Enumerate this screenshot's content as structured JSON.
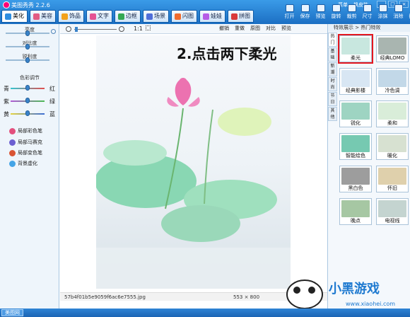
{
  "app": {
    "title": "美图秀秀 2.2.6",
    "menu": [
      "菜单",
      "换皮肤"
    ]
  },
  "tabs": [
    {
      "label": "美化",
      "icon": "brush-icon",
      "color": "#2f8ee0"
    },
    {
      "label": "美容",
      "icon": "face-icon",
      "color": "#e25b82"
    },
    {
      "label": "饰品",
      "icon": "gem-icon",
      "color": "#f2a21c"
    },
    {
      "label": "文字",
      "icon": "text-icon",
      "color": "#e55293"
    },
    {
      "label": "边框",
      "icon": "frame-icon",
      "color": "#34a853"
    },
    {
      "label": "场景",
      "icon": "scene-icon",
      "color": "#4f6ed9"
    },
    {
      "label": "闪图",
      "icon": "flash-icon",
      "color": "#ef6b2d"
    },
    {
      "label": "娃娃",
      "icon": "doll-icon",
      "color": "#b65ce6"
    },
    {
      "label": "拼图",
      "icon": "puzzle-icon",
      "color": "#d93939"
    }
  ],
  "toolbar": [
    "打开",
    "保存",
    "预览",
    "旋转",
    "裁剪",
    "尺寸",
    "涂抹",
    "消除",
    "撤销"
  ],
  "adjust": {
    "brightness": "亮度",
    "contrast": "对比度",
    "sharpness": "锐利度",
    "color_adjust": "色彩调节",
    "pairs": [
      {
        "left": "青",
        "right": "红"
      },
      {
        "left": "紫",
        "right": "绿"
      },
      {
        "left": "黄",
        "right": "蓝"
      }
    ]
  },
  "side_items": [
    {
      "label": "局部彩色笔",
      "icon": "color-pen-icon",
      "color": "#e34f7d"
    },
    {
      "label": "局部马赛克",
      "icon": "mosaic-icon",
      "color": "#6c5fd1"
    },
    {
      "label": "局部变色笔",
      "icon": "pen-icon",
      "color": "#d95434"
    },
    {
      "label": "背景虚化",
      "icon": "blur-icon",
      "color": "#44a4e6"
    }
  ],
  "view": {
    "zoom": "1:1",
    "actions": [
      "撤销",
      "重做",
      "原图",
      "对比",
      "预览"
    ]
  },
  "overlay_text": "2.点击两下柔光",
  "status": {
    "filename": "57b4f01b5e9059f6ac6e7555.jpg",
    "size": "553 × 800"
  },
  "effects": {
    "header": "特效展示 > 热门特效",
    "categories": [
      "热门",
      "基础",
      "新潮",
      "时尚",
      "节日",
      "其他"
    ],
    "items": [
      {
        "label": "柔光",
        "color": "#c8e7df",
        "selected": true
      },
      {
        "label": "经典LOMO",
        "color": "#a9b5b0",
        "selected": false
      },
      {
        "label": "经典影楼",
        "color": "#d8e6f3",
        "selected": false
      },
      {
        "label": "冷色调",
        "color": "#c2d8e8",
        "selected": false
      },
      {
        "label": "锐化",
        "color": "#9ed4c2",
        "selected": false
      },
      {
        "label": "柔和",
        "color": "#d9edd9",
        "selected": false
      },
      {
        "label": "智能绘色",
        "color": "#76c9b1",
        "selected": false
      },
      {
        "label": "暖化",
        "color": "#d7e1d1",
        "selected": false
      },
      {
        "label": "黑白色",
        "color": "#9d9d9d",
        "selected": false
      },
      {
        "label": "怀旧",
        "color": "#dfd0ac",
        "selected": false
      },
      {
        "label": "晚点",
        "color": "#a6c7a3",
        "selected": false
      },
      {
        "label": "电视线",
        "color": "#c4d4d0",
        "selected": false
      }
    ]
  },
  "bottom_tab": "美图网",
  "watermark": {
    "brand": "小黑游戏",
    "site": "www.xiaohei.com"
  }
}
